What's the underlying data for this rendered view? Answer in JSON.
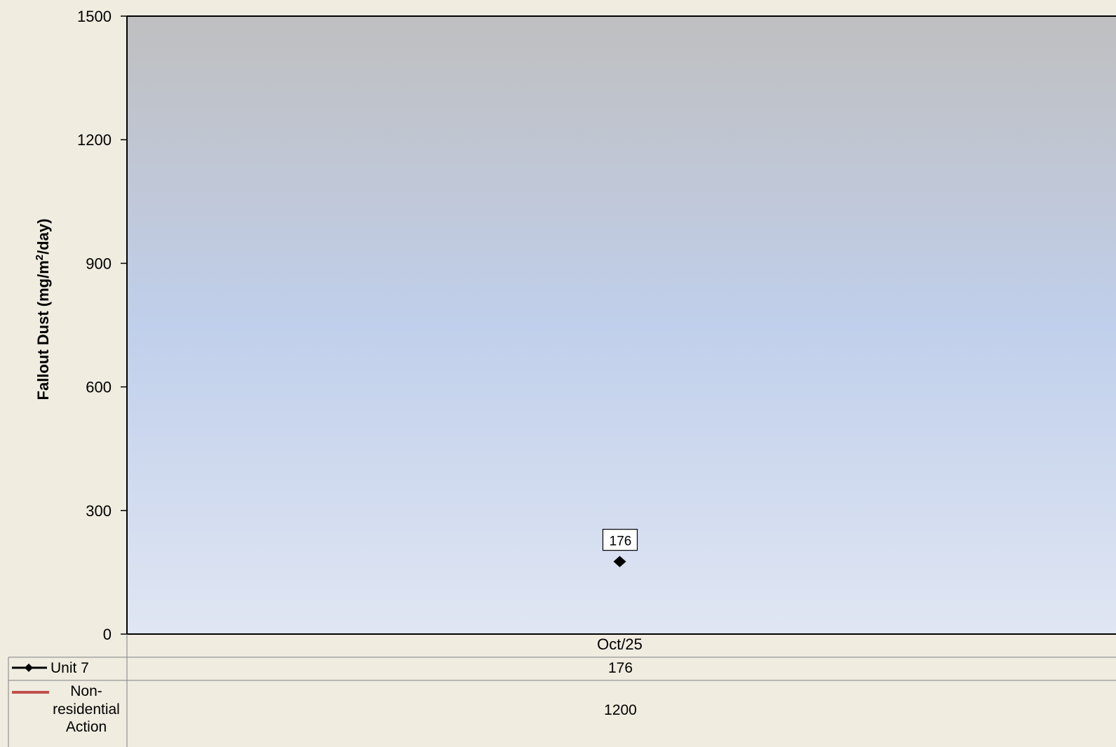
{
  "chart_data": {
    "type": "line",
    "title": "",
    "xlabel": "",
    "ylabel": "Fallout Dust (mg/m²/day)",
    "ylabel_parts": {
      "before": "Fallout Dust (mg/m",
      "sup": "2",
      "after": "/day)"
    },
    "ylim": [
      0,
      1500
    ],
    "yticks": [
      0,
      300,
      600,
      900,
      1200,
      1500
    ],
    "categories": [
      "Oct/25"
    ],
    "grid": false,
    "legend": "data-table-bottom",
    "series": [
      {
        "name": "Unit 7",
        "values": [
          176
        ],
        "color": "#000000",
        "marker": "diamond",
        "data_labels": true
      },
      {
        "name": "Non-residential Action",
        "name_lines": [
          "Non-",
          "residential",
          "Action"
        ],
        "values": [
          1200
        ],
        "color": "#c0504d",
        "marker": "none",
        "data_labels": false
      }
    ],
    "colors": {
      "plot_top": "#bfbfc0",
      "plot_mid": "#c0cfeb",
      "plot_bottom": "#e0e6f3",
      "background": "#f0ece0"
    }
  }
}
